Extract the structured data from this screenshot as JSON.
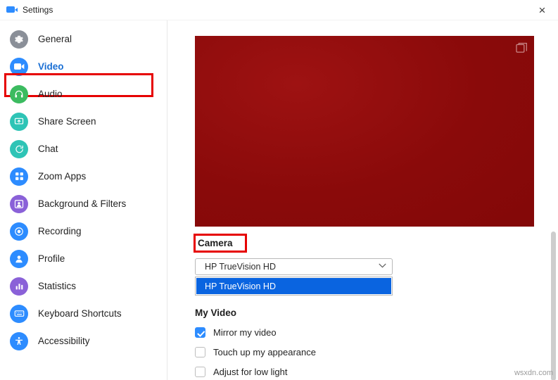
{
  "titlebar": {
    "title": "Settings",
    "app_icon": "zoom-camera-icon",
    "close_label": "×"
  },
  "sidebar": {
    "items": [
      {
        "label": "General",
        "icon": "gear-icon",
        "color": "#8a8f98"
      },
      {
        "label": "Video",
        "icon": "video-camera-icon",
        "color": "#2d8cff"
      },
      {
        "label": "Audio",
        "icon": "headset-icon",
        "color": "#3cbb60"
      },
      {
        "label": "Share Screen",
        "icon": "share-screen-icon",
        "color": "#2ec4b6"
      },
      {
        "label": "Chat",
        "icon": "chat-bubble-icon",
        "color": "#2ec4b6"
      },
      {
        "label": "Zoom Apps",
        "icon": "apps-grid-icon",
        "color": "#2d8cff"
      },
      {
        "label": "Background & Filters",
        "icon": "person-frame-icon",
        "color": "#8a61d8"
      },
      {
        "label": "Recording",
        "icon": "record-circle-icon",
        "color": "#2d8cff"
      },
      {
        "label": "Profile",
        "icon": "user-icon",
        "color": "#2d8cff"
      },
      {
        "label": "Statistics",
        "icon": "bar-chart-icon",
        "color": "#8a61d8"
      },
      {
        "label": "Keyboard Shortcuts",
        "icon": "keyboard-icon",
        "color": "#2d8cff"
      },
      {
        "label": "Accessibility",
        "icon": "accessibility-icon",
        "color": "#2d8cff"
      }
    ],
    "selected_index": 1,
    "highlight_color": "#e60000"
  },
  "content": {
    "camera": {
      "section_label": "Camera",
      "selected_value": "HP TrueVision HD",
      "chevron": "⌄",
      "options": [
        {
          "label": "HP TrueVision HD",
          "selected": true
        }
      ],
      "highlight_color": "#e60000"
    },
    "my_video": {
      "section_label": "My Video",
      "options": [
        {
          "label": "Mirror my video",
          "checked": true
        },
        {
          "label": "Touch up my appearance",
          "checked": false
        },
        {
          "label": "Adjust for low light",
          "checked": false
        }
      ]
    },
    "preview": {
      "icon": "picture-in-picture-icon",
      "background_color": "#8f0b0b"
    }
  },
  "watermark": "wsxdn.com"
}
